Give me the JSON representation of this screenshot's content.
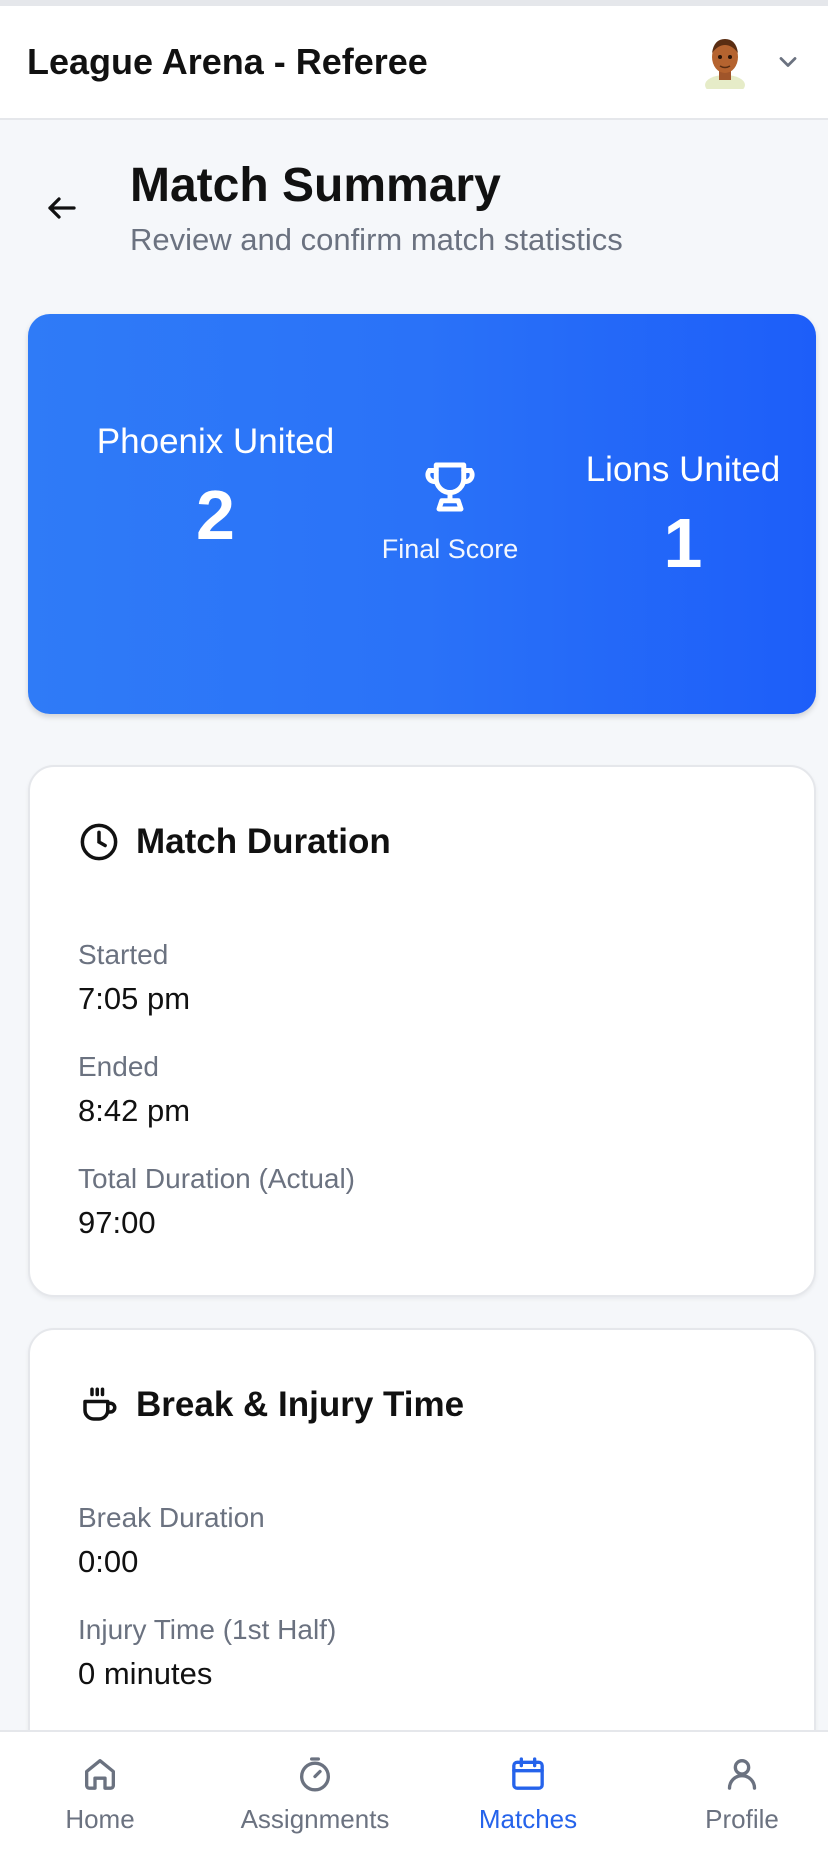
{
  "appbar": {
    "title": "League Arena - Referee",
    "avatar_icon": "user-avatar",
    "menu_icon": "chevron-down-icon"
  },
  "header": {
    "title": "Match Summary",
    "subtitle": "Review and confirm match statistics",
    "back_icon": "arrow-left-icon"
  },
  "score": {
    "home_team": "Phoenix United",
    "home_score": "2",
    "away_team": "Lions United",
    "away_score": "1",
    "label": "Final Score",
    "icon": "trophy-icon",
    "colors": {
      "gradient_start": "#2f7bf7",
      "gradient_end": "#1d5ef9"
    }
  },
  "duration": {
    "title": "Match Duration",
    "icon": "clock-icon",
    "started_label": "Started",
    "started_value": "7:05 pm",
    "ended_label": "Ended",
    "ended_value": "8:42 pm",
    "total_label": "Total Duration (Actual)",
    "total_value": "97:00"
  },
  "break_injury": {
    "title": "Break & Injury Time",
    "icon": "coffee-icon",
    "break_label": "Break Duration",
    "break_value": "0:00",
    "injury1_label": "Injury Time (1st Half)",
    "injury1_value": "0 minutes"
  },
  "nav": {
    "active": "Matches",
    "active_color": "#2563eb",
    "items": [
      {
        "label": "Home",
        "icon": "home-icon"
      },
      {
        "label": "Assignments",
        "icon": "stopwatch-icon"
      },
      {
        "label": "Matches",
        "icon": "calendar-icon"
      },
      {
        "label": "Profile",
        "icon": "user-icon"
      }
    ]
  }
}
